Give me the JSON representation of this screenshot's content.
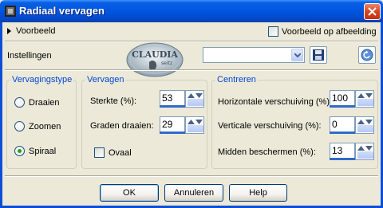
{
  "window": {
    "title": "Radiaal vervagen"
  },
  "preview": {
    "toggle_label": "Voorbeeld",
    "checkbox_label": "Voorbeeld op afbeelding"
  },
  "settings": {
    "label": "Instellingen",
    "logo_text": "CLAUDIA",
    "logo_subtext": "seitz",
    "preset_value": ""
  },
  "vervagingstype": {
    "legend": "Vervagingstype",
    "options": [
      "Draaien",
      "Zoomen",
      "Spiraal"
    ],
    "selected": "Spiraal"
  },
  "vervagen": {
    "legend": "Vervagen",
    "sterkte_label": "Sterkte (%):",
    "sterkte_value": "53",
    "graden_label": "Graden draaien:",
    "graden_value": "29",
    "ovaal_label": "Ovaal"
  },
  "centreren": {
    "legend": "Centreren",
    "horizontaal_label": "Horizontale verschuiving (%):",
    "horizontaal_value": "100",
    "verticaal_label": "Verticale verschuiving (%):",
    "verticaal_value": "0",
    "midden_label": "Midden beschermen (%):",
    "midden_value": "13"
  },
  "buttons": {
    "ok": "OK",
    "cancel": "Annuleren",
    "help": "Help"
  },
  "colors": {
    "title_bar": "#0054e3",
    "group_legend": "#0046d5",
    "dialog_bg": "#ece9d8"
  }
}
